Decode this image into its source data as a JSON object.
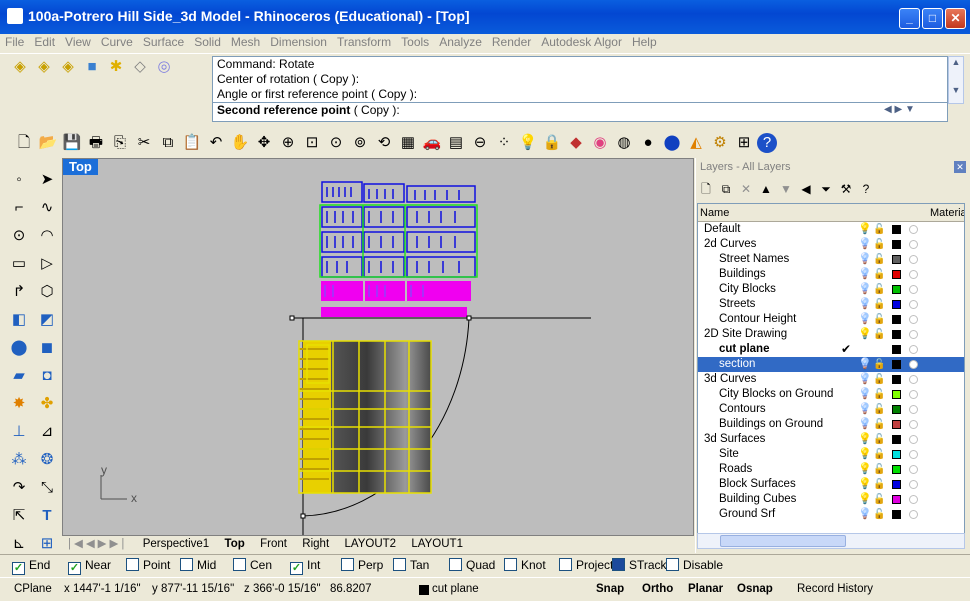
{
  "window": {
    "title": "100a-Potrero Hill Side_3d Model - Rhinoceros (Educational) - [Top]",
    "minimize": "_",
    "maximize": "□",
    "close": "✕"
  },
  "menu": [
    "File",
    "Edit",
    "View",
    "Curve",
    "Surface",
    "Solid",
    "Mesh",
    "Dimension",
    "Transform",
    "Tools",
    "Analyze",
    "Render",
    "Autodesk Algor",
    "Help"
  ],
  "command": {
    "lines": [
      "Command: Rotate",
      "Center of rotation ( Copy ):",
      "Angle or first reference point ( Copy ):"
    ],
    "prompt": "Second reference point",
    "prompt_option": " ( Copy ):"
  },
  "viewport": {
    "name": "Top",
    "axis_y": "y",
    "axis_x": "x"
  },
  "view_tabs": [
    "Perspective1",
    "Top",
    "Front",
    "Right",
    "LAYOUT2",
    "LAYOUT1"
  ],
  "view_tabs_active": "Top",
  "layers": {
    "title": "Layers - All Layers",
    "header_name": "Name",
    "header_material": "Material",
    "rows": [
      {
        "name": "Default",
        "child": false,
        "color": "#000000",
        "bulb": "yellow"
      },
      {
        "name": "2d Curves",
        "child": false,
        "color": "#000000",
        "bulb": "blue"
      },
      {
        "name": "Street Names",
        "child": true,
        "color": "#606060",
        "bulb": "blue"
      },
      {
        "name": "Buildings",
        "child": true,
        "color": "#E00000",
        "bulb": "blue"
      },
      {
        "name": "City Blocks",
        "child": true,
        "color": "#00C000",
        "bulb": "blue"
      },
      {
        "name": "Streets",
        "child": true,
        "color": "#0000E0",
        "bulb": "blue"
      },
      {
        "name": "Contour Height",
        "child": true,
        "color": "#000000",
        "bulb": "blue"
      },
      {
        "name": "2D Site Drawing",
        "child": false,
        "color": "#000000",
        "bulb": "yellow"
      },
      {
        "name": "cut plane",
        "child": true,
        "color": "#000000",
        "bulb": "",
        "current": true
      },
      {
        "name": "section",
        "child": true,
        "color": "#000000",
        "bulb": "blue",
        "selected": true
      },
      {
        "name": "3d Curves",
        "child": false,
        "color": "#000000",
        "bulb": "blue"
      },
      {
        "name": "City Blocks on Ground",
        "child": true,
        "color": "#80FF00",
        "bulb": "blue"
      },
      {
        "name": "Contours",
        "child": true,
        "color": "#008000",
        "bulb": "blue"
      },
      {
        "name": "Buildings on Ground",
        "child": true,
        "color": "#C04040",
        "bulb": "blue"
      },
      {
        "name": "3d Surfaces",
        "child": false,
        "color": "#000000",
        "bulb": "yellow"
      },
      {
        "name": "Site",
        "child": true,
        "color": "#00E0E0",
        "bulb": "yellow"
      },
      {
        "name": "Roads",
        "child": true,
        "color": "#00E000",
        "bulb": "yellow"
      },
      {
        "name": "Block Surfaces",
        "child": true,
        "color": "#0000E0",
        "bulb": "yellow"
      },
      {
        "name": "Building Cubes",
        "child": true,
        "color": "#E000E0",
        "bulb": "yellow"
      },
      {
        "name": "Ground Srf",
        "child": true,
        "color": "#000000",
        "bulb": "blue"
      }
    ]
  },
  "osnap": [
    {
      "label": "End",
      "checked": true
    },
    {
      "label": "Near",
      "checked": true
    },
    {
      "label": "Point",
      "checked": false
    },
    {
      "label": "Mid",
      "checked": false
    },
    {
      "label": "Cen",
      "checked": false
    },
    {
      "label": "Int",
      "checked": true
    },
    {
      "label": "Perp",
      "checked": false
    },
    {
      "label": "Tan",
      "checked": false
    },
    {
      "label": "Quad",
      "checked": false
    },
    {
      "label": "Knot",
      "checked": false
    },
    {
      "label": "Project",
      "checked": false
    },
    {
      "label": "STrack",
      "checked": true
    },
    {
      "label": "Disable",
      "checked": false
    }
  ],
  "status": {
    "cplane": "CPlane",
    "x": "x 1447'-1 1/16\"",
    "y": "y 877'-11 15/16\"",
    "z": "z 366'-0 15/16\"",
    "dist": "86.8207",
    "layer": "cut plane",
    "snap": "Snap",
    "ortho": "Ortho",
    "planar": "Planar",
    "osnap": "Osnap",
    "record": "Record History"
  }
}
